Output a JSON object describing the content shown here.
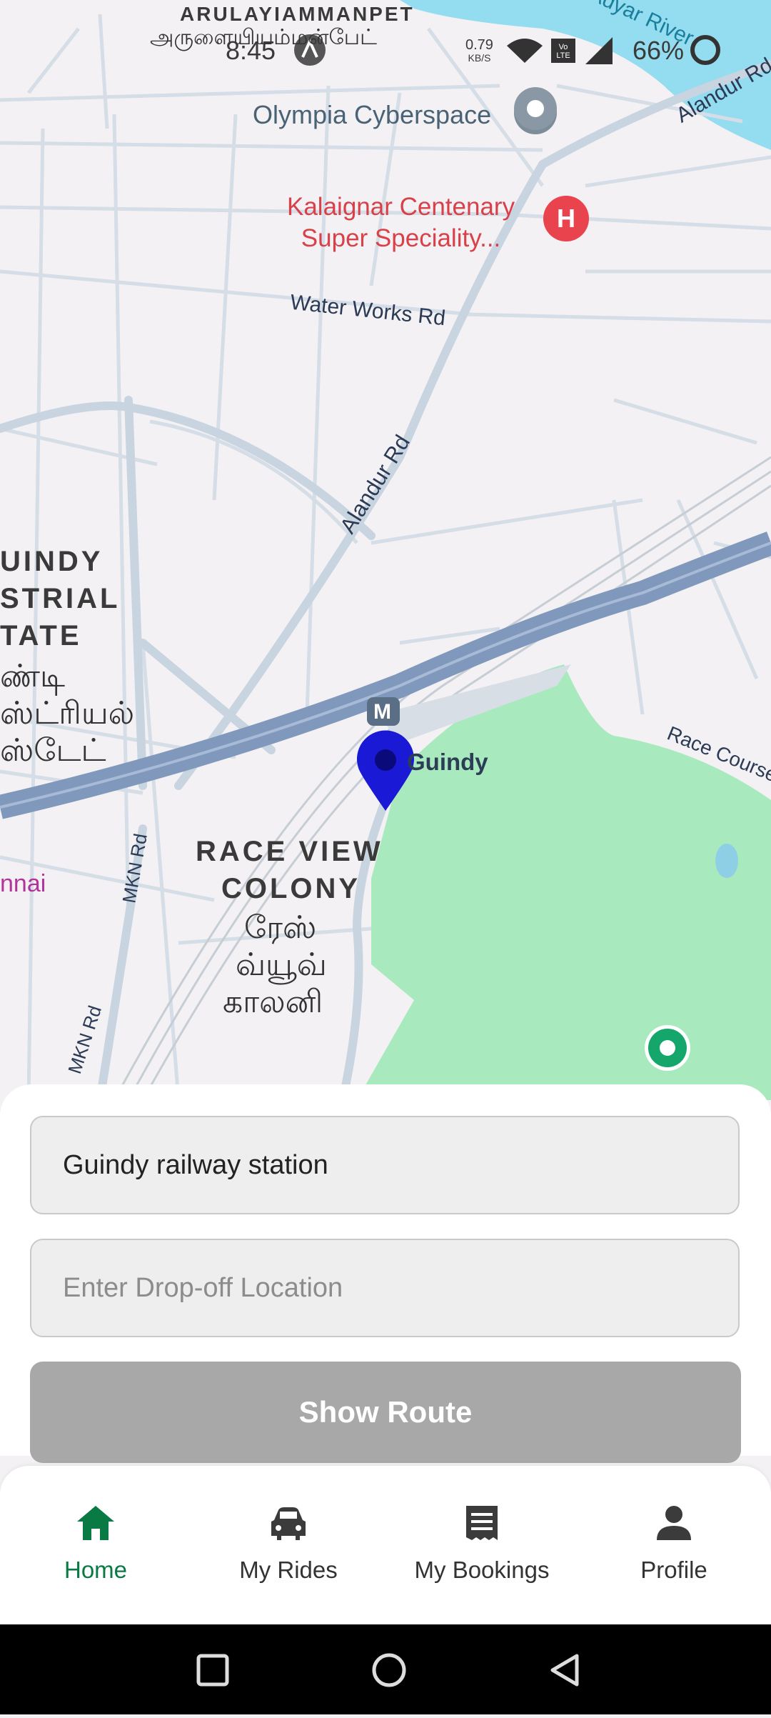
{
  "status_bar": {
    "time": "8:45",
    "net_speed_value": "0.79",
    "net_speed_unit": "KB/S",
    "volte": "Vo LTE",
    "battery": "66%"
  },
  "map": {
    "labels": {
      "arulayiammanpet_en": "ARULAYIAMMANPET",
      "arulayiammanpet_ta": "அருளையியம்மன்பேட்",
      "olympia": "Olympia Cyberspace",
      "hospital_line1": "Kalaignar Centenary",
      "hospital_line2": "Super Speciality...",
      "water_works": "Water Works Rd",
      "alandur_rd": "Alandur Rd",
      "alandur_rd_top": "Alandur Rd",
      "adyar_river": "Adyar River",
      "guindy_estate_1": "UINDY",
      "guindy_estate_2": "STRIAL",
      "guindy_estate_3": "TATE",
      "guindy_ta_1": "ண்டி",
      "guindy_ta_2": "ஸ்ட்ரியல்",
      "guindy_ta_3": "ஸ்டேட்",
      "guindy_station": "Guindy",
      "metro_badge": "M",
      "race_view_1": "RACE VIEW",
      "race_view_2": "COLONY",
      "race_view_ta_1": "ரேஸ்",
      "race_view_ta_2": "வ்யூவ்",
      "race_view_ta_3": "காலனி",
      "race_course": "Race Course",
      "mkn_rd_1": "MKN Rd",
      "mkn_rd_2": "MKN Rd",
      "chennai_partial": "nnai",
      "hospital_badge": "H"
    }
  },
  "booking": {
    "pickup_value": "Guindy railway station",
    "dropoff_placeholder": "Enter Drop-off Location",
    "show_route_label": "Show Route"
  },
  "nav": {
    "items": [
      {
        "label": "Home",
        "icon": "home-icon",
        "active": true
      },
      {
        "label": "My Rides",
        "icon": "car-icon",
        "active": false
      },
      {
        "label": "My Bookings",
        "icon": "receipt-icon",
        "active": false
      },
      {
        "label": "Profile",
        "icon": "person-icon",
        "active": false
      }
    ]
  },
  "colors": {
    "accent": "#0a7a45",
    "pin": "#1a1ad6",
    "button_disabled": "#a8a8a8",
    "park": "#a9e9be",
    "river": "#94dcef",
    "highway": "#8aa2c4"
  }
}
